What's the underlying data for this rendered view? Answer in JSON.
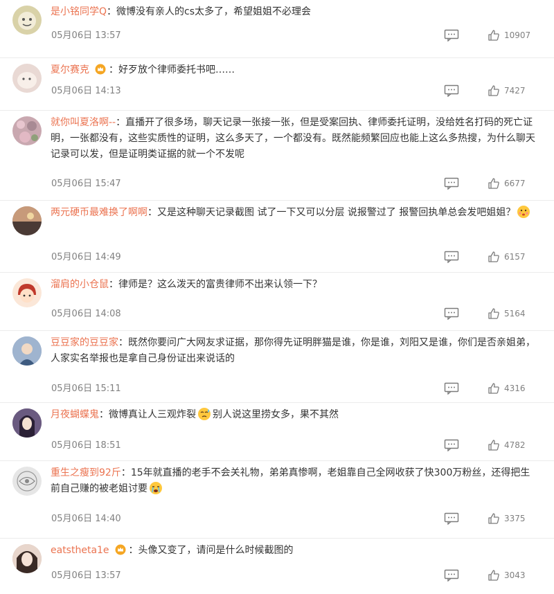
{
  "comments": [
    {
      "username": "是小铭同学Q",
      "text": "微博没有亲人的cs太多了，希望姐姐不必理会",
      "time": "05月06日 13:57",
      "likes": "10907",
      "avatar_color": "#d9d2a8"
    },
    {
      "username": "夏尔赛克",
      "text": "好歹放个律师委托书吧……",
      "time": "05月06日 14:13",
      "likes": "7427",
      "avatar_color": "#e9d9d4",
      "badge": "crown-badge-icon"
    },
    {
      "username": "就你叫夏洛啊--",
      "text": "直播开了很多场，聊天记录一张接一张，但是受案回执、律师委托证明，没给姓名打码的死亡证明，一张都没有，这些实质性的证明，这么多天了，一个都没有。既然能频繁回应也能上这么多热搜，为什么聊天记录可以发，但是证明类证据的就一个不发呢",
      "time": "05月06日 15:47",
      "likes": "6677",
      "avatar_color": "#c9a8b0"
    },
    {
      "username": "两元硬币最难换了啊啊",
      "text": "又是这种聊天记录截图 试了一下又可以分层 说报警过了 报警回执单总会发吧姐姐？",
      "time": "05月06日 14:49",
      "likes": "6157",
      "avatar_color": "#8a6a55",
      "emoji": "thinking-emoji-icon"
    },
    {
      "username": "溜肩的小仓鼠",
      "text": "律师是？这么泼天的富贵律师不出来认领一下？",
      "time": "05月06日 14:08",
      "likes": "5164",
      "avatar_color": "#e0704a"
    },
    {
      "username": "豆豆家的豆豆家",
      "text": "既然你要问广大网友求证据，那你得先证明胖猫是谁，你是谁，刘阳又是谁，你们是否亲姐弟，人家实名举报也是拿自己身份证出来说话的",
      "time": "05月06日 15:11",
      "likes": "4316",
      "avatar_color": "#7a95b8"
    },
    {
      "username": "月夜蝴蝶鬼",
      "text_before": "微博真让人三观炸裂",
      "text_after": "别人说这里捞女多，果不其然",
      "time": "05月06日 18:51",
      "likes": "4782",
      "avatar_color": "#5a4a6a",
      "emoji": "sweat-emoji-icon"
    },
    {
      "username": "重生之瘦到92斤",
      "text": "15年就直播的老手不会关礼物，弟弟真惨啊，老姐靠自己全网收获了快300万粉丝，还得把生前自己赚的被老姐讨要",
      "time": "05月06日 14:40",
      "likes": "3375",
      "avatar_color": "#d8d8d8",
      "emoji": "crying-emoji-icon"
    },
    {
      "username": "eatstheta1e",
      "text": "头像又变了，请问是什么时候截图的",
      "time": "05月06日 13:57",
      "likes": "3043",
      "avatar_color": "#c9a89a",
      "badge": "crown-badge-icon"
    }
  ]
}
